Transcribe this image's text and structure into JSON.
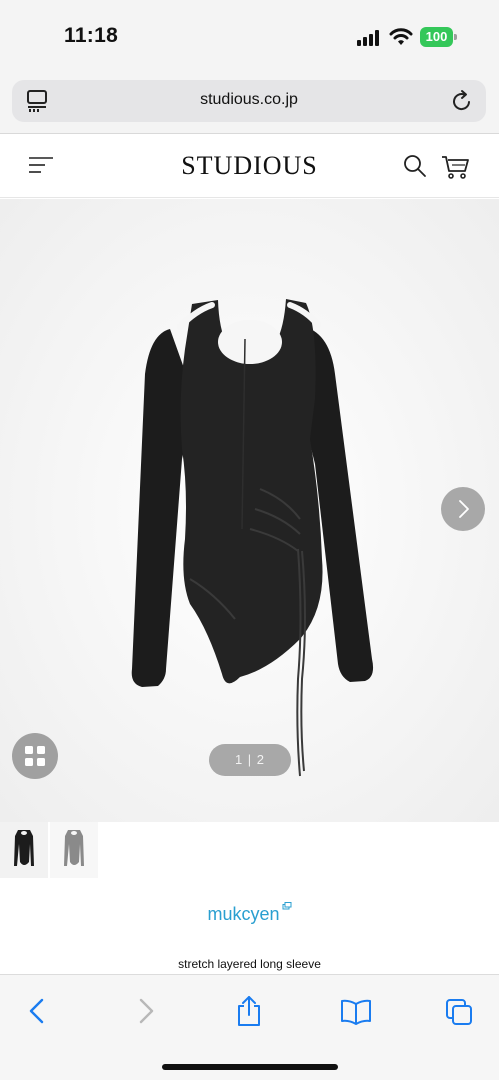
{
  "status_bar": {
    "time": "11:18",
    "battery": "100",
    "battery_color": "#34c759"
  },
  "browser": {
    "url": "studious.co.jp"
  },
  "site": {
    "logo": "STUDIOUS",
    "accent_color": "#2a9fd0"
  },
  "gallery": {
    "pager": "1 | 2",
    "current_image": 1,
    "total_images": 2
  },
  "product": {
    "brand": "mukcyen",
    "name": "stretch layered long sleeve"
  },
  "icons": {
    "reader": "reader-mode-icon",
    "reload": "reload-icon",
    "menu": "menu-icon",
    "search": "search-icon",
    "cart": "cart-icon",
    "next": "chevron-right-icon",
    "grid": "grid-icon",
    "back": "chevron-left-icon",
    "forward": "chevron-right-icon",
    "share": "share-icon",
    "bookmarks": "book-icon",
    "tabs": "tabs-icon"
  }
}
